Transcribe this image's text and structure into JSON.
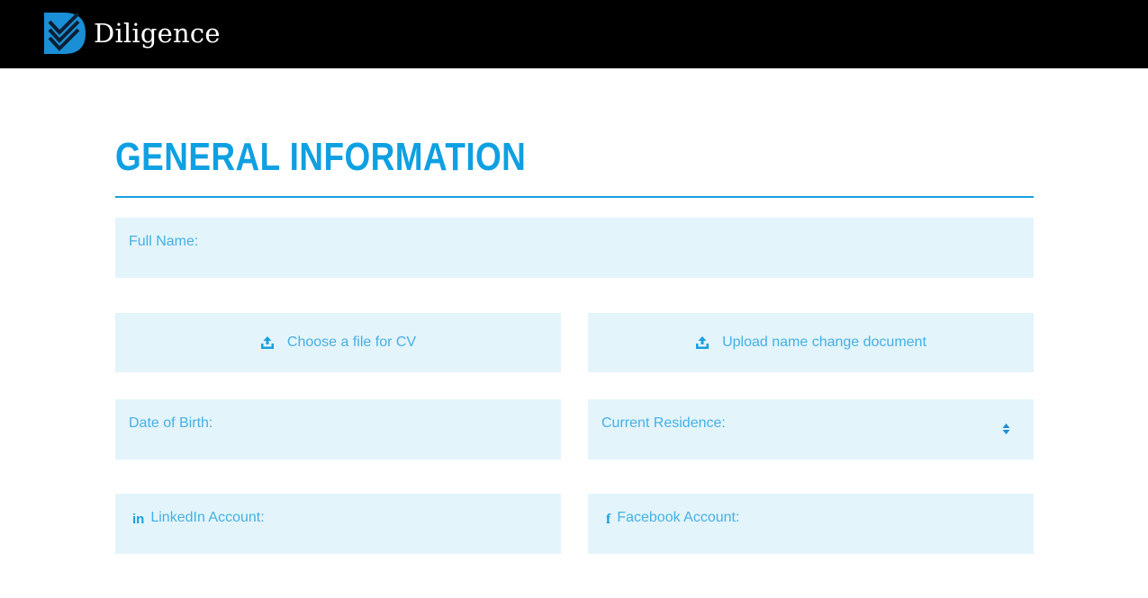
{
  "header": {
    "brand_name": "Diligence",
    "logo_icon": "diligence-logo-icon",
    "background": "#000000"
  },
  "main": {
    "title": "GENERAL INFORMATION",
    "accent_color": "#0fa0e2",
    "field_background": "#e3f4fb",
    "fields": {
      "full_name": {
        "label": "Full Name:"
      },
      "cv_upload": {
        "label": "Choose a file for CV",
        "icon": "upload-icon"
      },
      "name_change_upload": {
        "label": "Upload name change document",
        "icon": "upload-icon"
      },
      "date_of_birth": {
        "label": "Date of Birth:"
      },
      "current_residence": {
        "label": "Current Residence:",
        "icon": "select-arrows-icon"
      },
      "linkedin": {
        "label": "LinkedIn Account:",
        "icon": "linkedin-icon"
      },
      "facebook": {
        "label": "Facebook Account:",
        "icon": "facebook-icon"
      }
    }
  }
}
